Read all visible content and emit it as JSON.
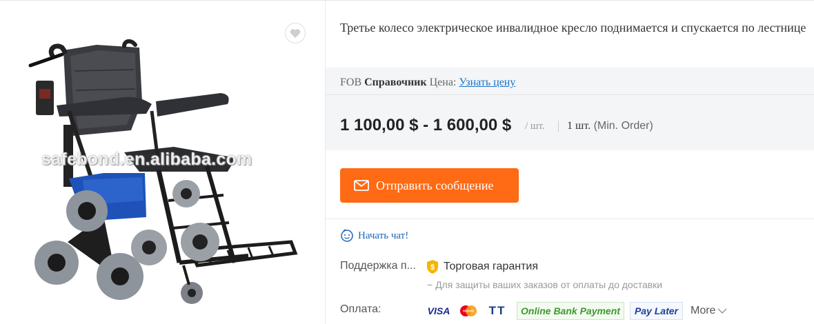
{
  "product": {
    "title": "Третье колесо электрическое инвалидное кресло поднимается и спускается по лестнице",
    "watermark": "safebond.en.alibaba.com",
    "image_icon": "wheelchair-image"
  },
  "fob": {
    "prefix": "FOB",
    "label": "Справочник",
    "price_label": "Цена:",
    "link": "Узнать цену"
  },
  "price": {
    "range": "1 100,00 $ - 1 600,00 $",
    "unit": "/ шт.",
    "moq_qty": "1 шт.",
    "moq_label": "(Min. Order)"
  },
  "actions": {
    "send_message": "Отправить сообщение",
    "chat": "Начать чат!"
  },
  "support": {
    "label": "Поддержка п...",
    "trade_assurance": "Торговая гарантия",
    "note": "− Для защиты ваших заказов от оплаты до доставки"
  },
  "payment": {
    "label": "Оплата:",
    "methods": [
      "VISA",
      "TT",
      "Online Bank Payment",
      "Pay Later"
    ],
    "more": "More"
  },
  "colors": {
    "accent_orange": "#ff6a14",
    "link_blue": "#1a73c9",
    "panel_gray": "#f4f5f7"
  }
}
